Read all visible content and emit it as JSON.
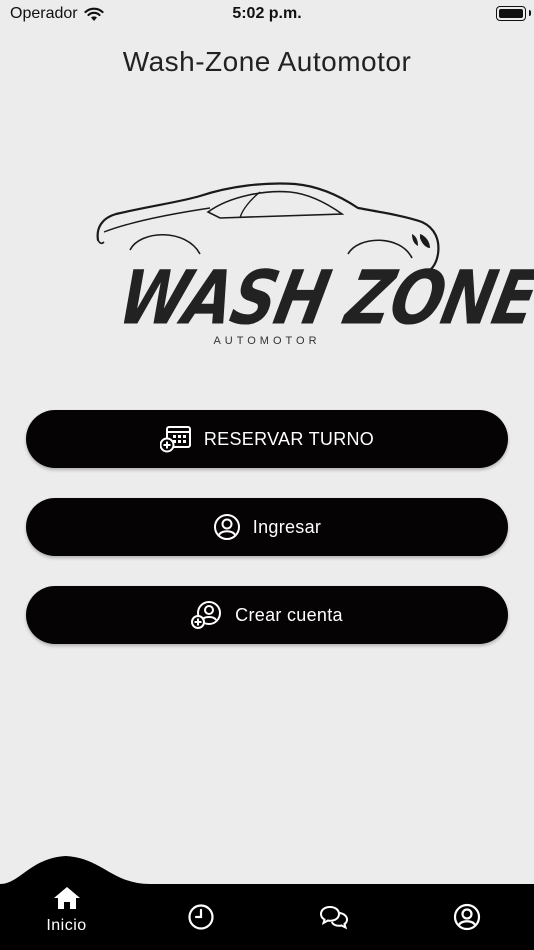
{
  "status_bar": {
    "carrier": "Operador",
    "time": "5:02 p.m."
  },
  "header": {
    "title": "Wash-Zone Automotor"
  },
  "logo": {
    "main_text": "WASH ZONE",
    "sub_text": "AUTOMOTOR"
  },
  "actions": {
    "reserve_label": "RESERVAR TURNO",
    "login_label": "Ingresar",
    "signup_label": "Crear cuenta"
  },
  "tabbar": {
    "home_label": "Inicio",
    "icons": [
      "home-icon",
      "clock-icon",
      "chat-icon",
      "user-circle-icon"
    ]
  },
  "colors": {
    "background": "#ececec",
    "button": "#050303",
    "tabbar": "#000000",
    "text_on_dark": "#ffffff"
  }
}
